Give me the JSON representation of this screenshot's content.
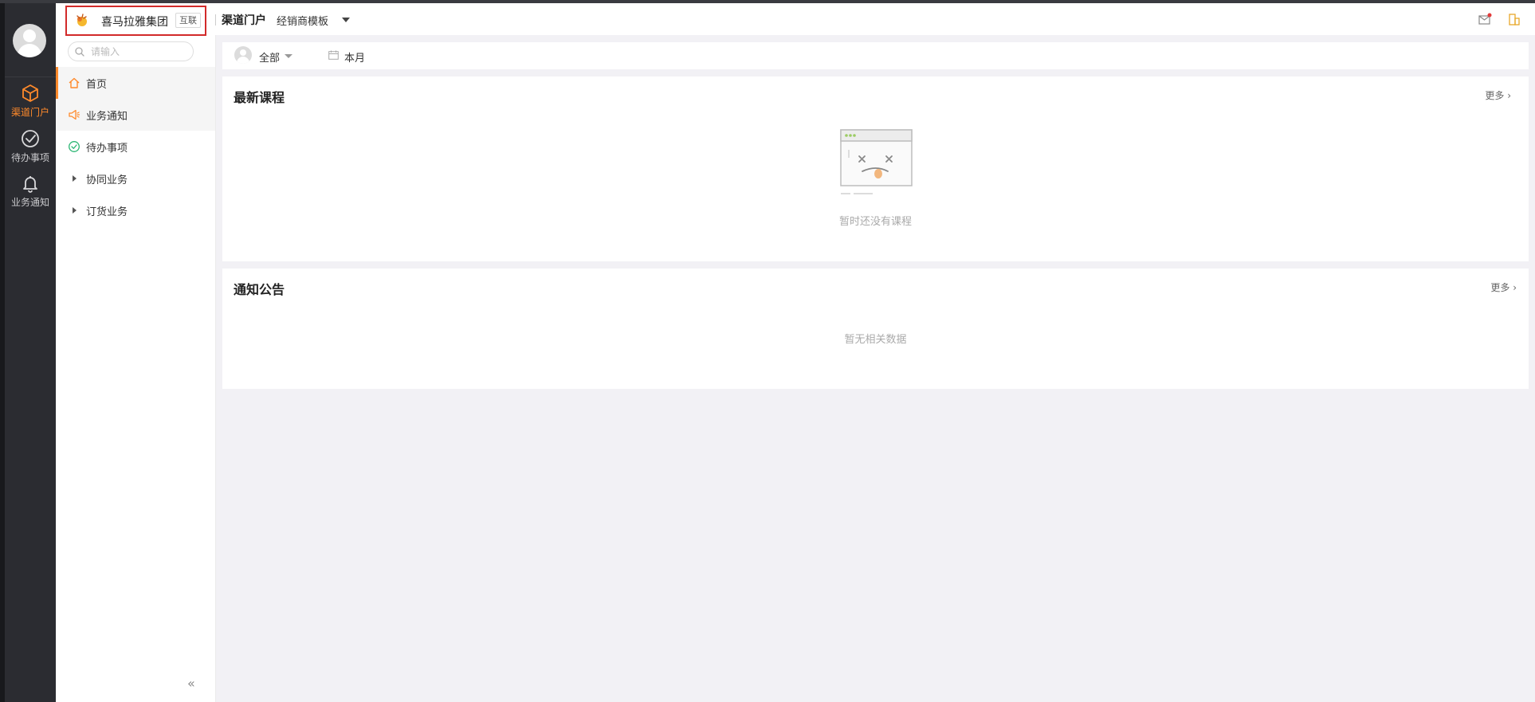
{
  "rail": {
    "items": [
      {
        "label": "渠道门户",
        "icon": "cube-icon",
        "active": true
      },
      {
        "label": "待办事项",
        "icon": "check-circle-icon",
        "active": false
      },
      {
        "label": "业务通知",
        "icon": "bell-icon",
        "active": false
      }
    ]
  },
  "sidebar": {
    "org_name": "喜马拉雅集团",
    "org_tag": "互联",
    "search_placeholder": "请输入",
    "items": [
      {
        "label": "首页",
        "icon": "home-icon"
      },
      {
        "label": "业务通知",
        "icon": "speaker-icon"
      },
      {
        "label": "待办事项",
        "icon": "check-circle-icon"
      },
      {
        "label": "协同业务",
        "icon": "caret-right-icon"
      },
      {
        "label": "订货业务",
        "icon": "caret-right-icon"
      }
    ],
    "collapse_glyph": "«"
  },
  "header": {
    "title": "渠道门户",
    "template": "经销商模板"
  },
  "filter": {
    "scope": "全部",
    "period": "本月"
  },
  "courses": {
    "title": "最新课程",
    "more": "更多",
    "empty": "暂时还没有课程"
  },
  "notices": {
    "title": "通知公告",
    "more": "更多",
    "empty": "暂无相关数据"
  },
  "colors": {
    "accent": "#ff8a2b",
    "rail_bg": "#2b2c31",
    "page_bg": "#f2f1f5",
    "highlight_border": "#d22a2a"
  }
}
